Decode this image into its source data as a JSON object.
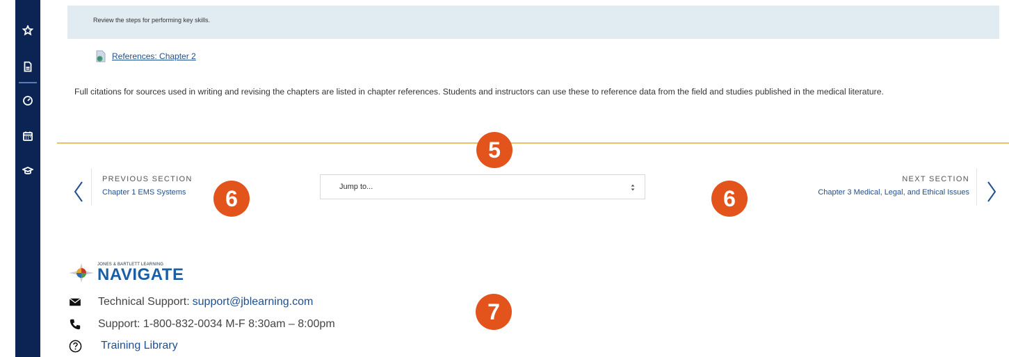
{
  "info": {
    "text": "Review the steps for performing key skills."
  },
  "references": {
    "link_label": "References: Chapter 2",
    "description": "Full citations for sources used in writing and revising the chapters are listed in chapter references. Students and instructors can use these to reference data from the field and studies published in the medical literature."
  },
  "nav": {
    "prev_kicker": "PREVIOUS SECTION",
    "prev_label": "Chapter 1 EMS Systems",
    "jump_placeholder": "Jump to...",
    "next_kicker": "NEXT SECTION",
    "next_label": "Chapter 3 Medical, Legal, and Ethical Issues"
  },
  "callouts": {
    "five": "5",
    "six_left": "6",
    "six_right": "6",
    "seven": "7"
  },
  "footer": {
    "logo_small": "JONES & BARTLETT LEARNING",
    "logo_big": "NAVIGATE",
    "tech_label": "Technical Support: ",
    "tech_email": "support@jblearning.com",
    "phone": "Support: 1-800-832-0034 M-F 8:30am – 8:00pm",
    "training": "Training Library"
  },
  "rail_icons": [
    "star-icon",
    "document-icon",
    "dashboard-gauge-icon",
    "calendar-icon",
    "graduation-cap-icon"
  ],
  "colors": {
    "rail": "#0c2454",
    "accent_link": "#1d4f91",
    "badge": "#e2541c",
    "gold_rule": "#e8c265",
    "info_bg": "#e1ebf2"
  }
}
